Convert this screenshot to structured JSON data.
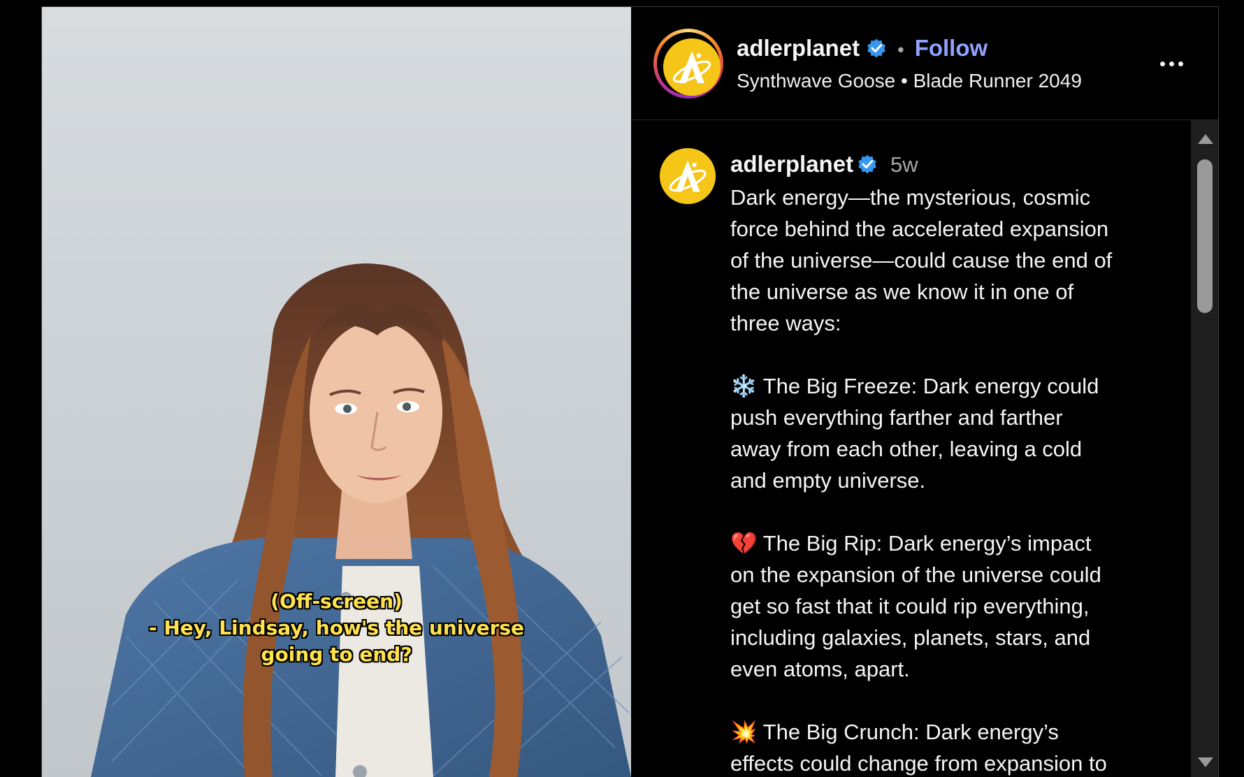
{
  "video": {
    "captions": [
      "(Off-screen)",
      "- Hey, Lindsay, how's the universe",
      "going to end?"
    ]
  },
  "header": {
    "username": "adlerplanet",
    "separator": "•",
    "follow_label": "Follow",
    "audio_track": "Synthwave Goose • Blade Runner 2049",
    "verified_icon": "verified-badge-icon",
    "more_icon": "more-options-icon"
  },
  "post": {
    "username": "adlerplanet",
    "time_ago": "5w",
    "intro_lines": [
      "Dark energy—the mysterious, cosmic",
      "force behind the accelerated expansion",
      "of the universe—could cause the end of",
      "the universe as we know it in one of",
      "three ways:"
    ],
    "freeze_lines": [
      "❄️ The Big Freeze: Dark energy could",
      "push everything farther and farther",
      "away from each other, leaving a cold",
      "and empty universe."
    ],
    "rip_lines": [
      "💔 The Big Rip: Dark energy’s impact",
      "on the expansion of the universe could",
      "get so fast that it could rip everything,",
      "including galaxies, planets, stars, and",
      "even atoms, apart."
    ],
    "crunch_lines": [
      "💥 The Big Crunch: Dark energy’s",
      "effects could change from expansion to"
    ]
  },
  "colors": {
    "brand_yellow": "#f5c518",
    "follow_blue": "#8fa2ff",
    "verified_blue": "#3797f0",
    "caption_yellow": "#ffe14d"
  }
}
